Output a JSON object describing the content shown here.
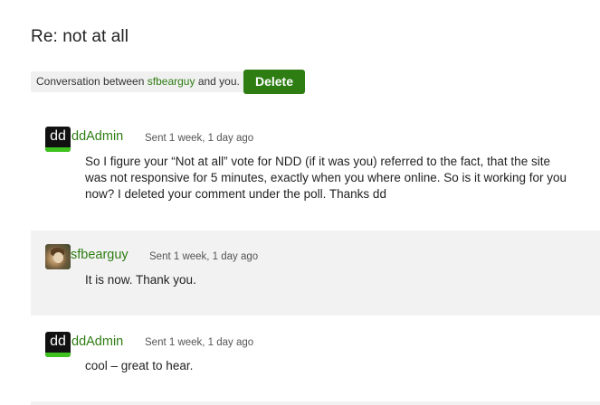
{
  "page": {
    "title": "Re: not at all"
  },
  "conversation": {
    "prefix": "Conversation between",
    "other_user": "sfbearguy",
    "suffix": "and you.",
    "delete_label": "Delete"
  },
  "messages": [
    {
      "author": "ddAdmin",
      "avatar_text": "dd",
      "sent": "Sent 1 week, 1 day ago",
      "body": "So I figure your “Not at all” vote for NDD (if it was you) referred to the fact, that the site was not responsive for 5 minutes, exactly when you where online. So is it working for you now? I deleted your comment under the poll. Thanks dd"
    },
    {
      "author": "sfbearguy",
      "sent": "Sent 1 week, 1 day ago",
      "body": "It is now. Thank you."
    },
    {
      "author": "ddAdmin",
      "avatar_text": "dd",
      "sent": "Sent 1 week, 1 day ago",
      "body": "cool – great to hear."
    }
  ],
  "colors": {
    "accent": "#2e7d13",
    "alt_row": "#f2f2f2",
    "avatar_bar": "#3fc21f"
  }
}
